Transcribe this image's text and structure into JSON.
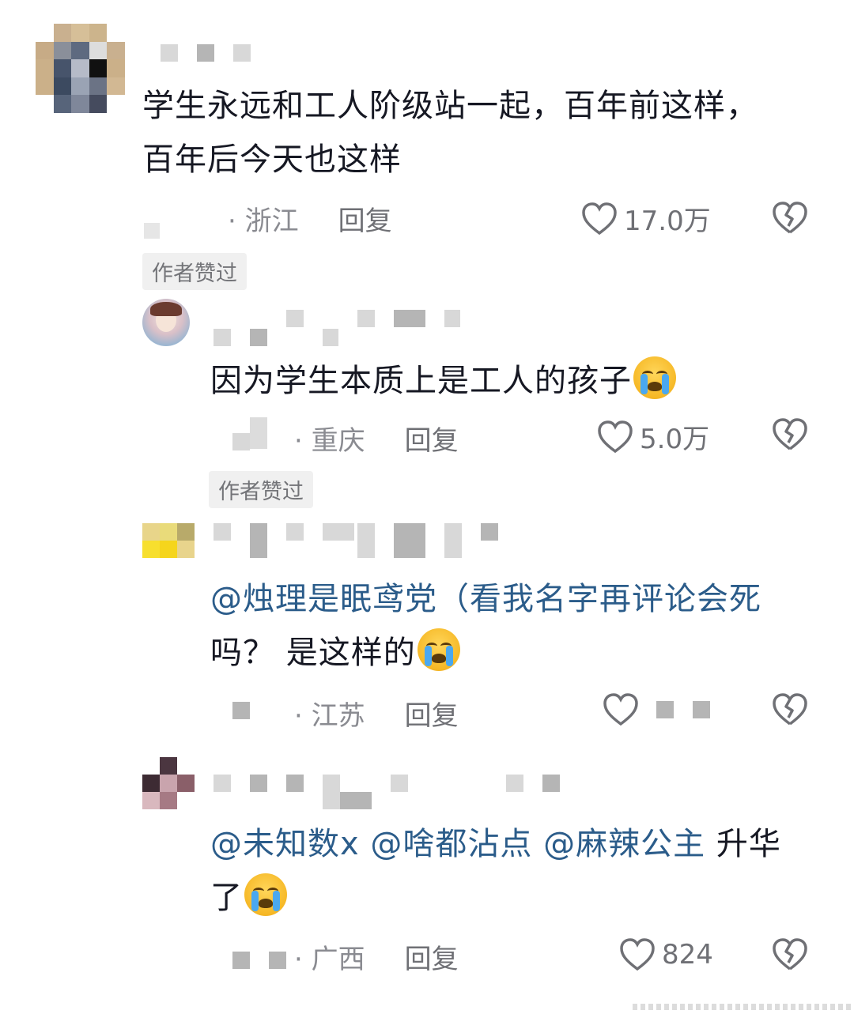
{
  "comments": [
    {
      "text": "学生永远和工人阶级站一起，百年前这样，百年后今天也这样",
      "location": "· 浙江",
      "reply_label": "回复",
      "likes": "17.0万",
      "badge": "作者赞过"
    },
    {
      "text": "因为学生本质上是工人的孩子",
      "location": "· 重庆",
      "reply_label": "回复",
      "likes": "5.0万",
      "badge": "作者赞过"
    },
    {
      "mention": "@烛理是眠鸢党（看我名字再评论会死",
      "text_rest": "吗？ 是这样的",
      "location": "· 江苏",
      "reply_label": "回复"
    },
    {
      "mention1": "@未知数x @啥都沾点 @麻辣公主",
      "text_rest": " 升华",
      "text_line2": "了",
      "location": "· 广西",
      "reply_label": "回复",
      "likes": "824"
    }
  ],
  "icons": {
    "like": "heart-outline-icon",
    "dislike": "broken-heart-icon",
    "emoji": "loudly-crying-face-emoji"
  },
  "colors": {
    "mention": "#2b5c8a",
    "meta": "#8a8b91",
    "badge_bg": "#f0f0f0"
  }
}
